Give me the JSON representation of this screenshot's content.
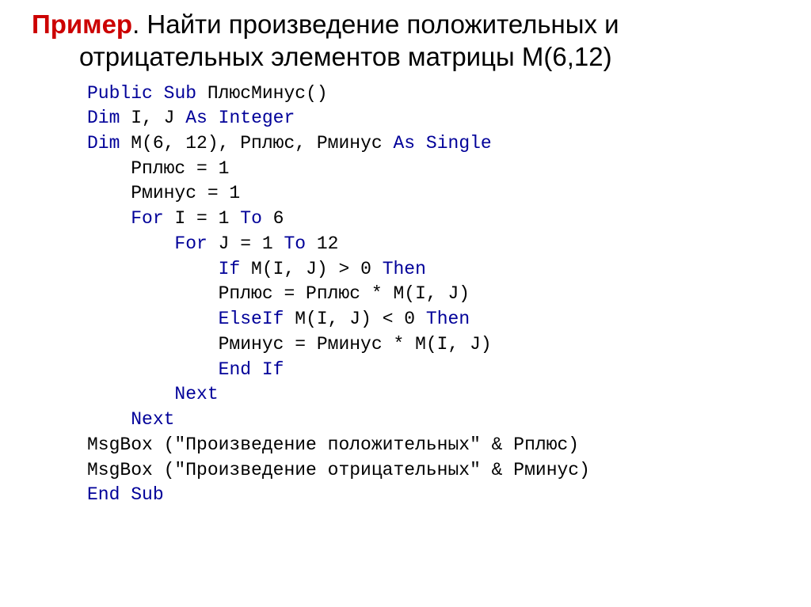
{
  "title": {
    "example_label": "Пример",
    "line1_rest": ". Найти произведение положительных и",
    "line2": "отрицательных элементов матрицы M(6,12)"
  },
  "code": {
    "l1_kw1": "Public",
    "l1_kw2": "Sub",
    "l1_rest": " ПлюсМинус()",
    "l2_kw1": "Dim",
    "l2_mid": " I, J ",
    "l2_kw2": "As",
    "l2_kw3": "Integer",
    "l3_kw1": "Dim",
    "l3_mid": " M(6, 12), Рплюс, Рминус ",
    "l3_kw2": "As",
    "l3_kw3": "Single",
    "l4": "    Рплюс = 1",
    "l5": "    Рминус = 1",
    "l6_pre": "    ",
    "l6_kw1": "For",
    "l6_mid": " I = 1 ",
    "l6_kw2": "To",
    "l6_rest": " 6",
    "l7_pre": "        ",
    "l7_kw1": "For",
    "l7_mid": " J = 1 ",
    "l7_kw2": "To",
    "l7_rest": " 12",
    "l8_pre": "            ",
    "l8_kw1": "If",
    "l8_mid": " M(I, J) > 0 ",
    "l8_kw2": "Then",
    "l9": "            Рплюс = Рплюс * M(I, J)",
    "l10_pre": "            ",
    "l10_kw1": "ElseIf",
    "l10_mid": " M(I, J) < 0 ",
    "l10_kw2": "Then",
    "l11": "            Рминус = Рминус * M(I, J)",
    "l12_pre": "            ",
    "l12_kw1": "End",
    "l12_kw2": "If",
    "l13_pre": "        ",
    "l13_kw1": "Next",
    "l14_pre": "    ",
    "l14_kw1": "Next",
    "l15": "MsgBox (\"Произведение положительных\" & Рплюс)",
    "l16": "MsgBox (\"Произведение отрицательных\" & Рминус)",
    "l17_kw1": "End",
    "l17_kw2": "Sub"
  }
}
